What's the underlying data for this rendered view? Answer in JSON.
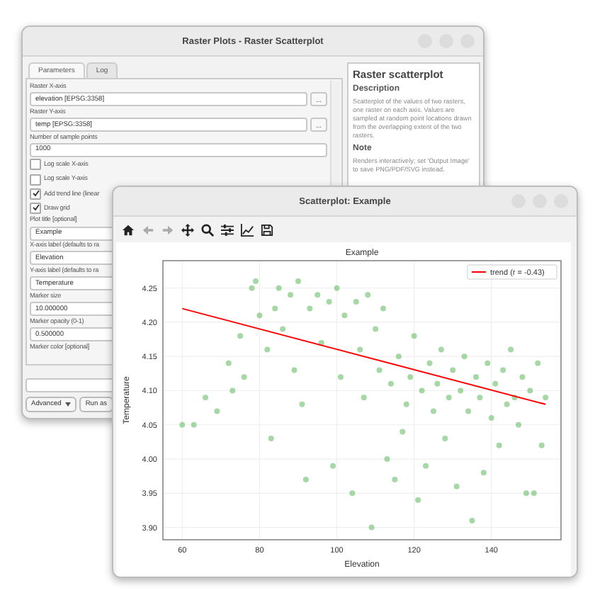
{
  "back_window": {
    "title": "Raster Plots - Raster Scatterplot",
    "tabs": [
      {
        "label": "Parameters",
        "selected": true
      },
      {
        "label": "Log",
        "selected": false
      }
    ],
    "parameters": [
      {
        "kind": "combo",
        "label": "Raster X-axis",
        "value": "elevation [EPSG:3358]",
        "button": "..."
      },
      {
        "kind": "combo",
        "label": "Raster Y-axis",
        "value": "temp [EPSG:3358]",
        "button": "..."
      },
      {
        "kind": "number",
        "label": "Number of sample points",
        "value": "1000"
      },
      {
        "kind": "checkbox",
        "label": "Log scale X-axis",
        "checked": false
      },
      {
        "kind": "checkbox",
        "label": "Log scale Y-axis",
        "checked": false
      },
      {
        "kind": "checkbox",
        "label": "Add trend line (linear",
        "checked": true
      },
      {
        "kind": "checkbox",
        "label": "Draw grid",
        "checked": true
      },
      {
        "kind": "text",
        "label": "Plot title [optional]",
        "value": "Example"
      },
      {
        "kind": "text",
        "label": "X-axis label (defaults to ra",
        "value": "Elevation"
      },
      {
        "kind": "text",
        "label": "Y-axis label (defaults to ra",
        "value": "Temperature"
      },
      {
        "kind": "text",
        "label": "Marker size",
        "value": "10.000000"
      },
      {
        "kind": "text",
        "label": "Marker opacity (0-1)",
        "value": "0.500000"
      },
      {
        "kind": "heading",
        "label": "Marker color [optional]"
      }
    ],
    "buttons": [
      {
        "label": "Advanced",
        "kind": "menu"
      },
      {
        "label": "Run as",
        "kind": "plain"
      }
    ],
    "help": {
      "title": "Raster scatterplot",
      "sections": [
        {
          "heading": "Description",
          "text": "Scatterplot of the values of two rasters, one raster on each axis. Values are sampled at random point locations drawn from the overlapping extent of the two rasters."
        },
        {
          "heading": "Note",
          "text": "Renders interactively; set 'Output Image' to save PNG/PDF/SVG instead."
        }
      ]
    }
  },
  "plot_window": {
    "title": "Scatterplot: Example",
    "toolbar": [
      {
        "kind": "home",
        "disabled": false
      },
      {
        "kind": "back",
        "disabled": true
      },
      {
        "kind": "forward",
        "disabled": true
      },
      {
        "kind": "pan",
        "disabled": false
      },
      {
        "kind": "zoom",
        "disabled": false
      },
      {
        "kind": "configure",
        "disabled": false
      },
      {
        "kind": "axes",
        "disabled": false
      },
      {
        "kind": "save",
        "disabled": false
      }
    ],
    "chart_data": {
      "type": "scatter",
      "title": "Example",
      "xlabel": "Elevation",
      "ylabel": "Temperature",
      "xlim": [
        55,
        158
      ],
      "ylim": [
        3.882,
        4.29
      ],
      "xticks": [
        60,
        80,
        100,
        120,
        140
      ],
      "yticks": [
        {
          "value": 3.9,
          "label": "3.90"
        },
        {
          "value": 3.95,
          "label": "3.95"
        },
        {
          "value": 4.0,
          "label": "4.00"
        },
        {
          "value": 4.05,
          "label": "4.05"
        },
        {
          "value": 4.1,
          "label": "4.10"
        },
        {
          "value": 4.15,
          "label": "4.15"
        },
        {
          "value": 4.2,
          "label": "4.20"
        },
        {
          "value": 4.25,
          "label": "4.25"
        }
      ],
      "series": [
        {
          "name": "trend (r = -0.43)",
          "type": "line",
          "color": "#ff0000",
          "x": [
            60,
            154
          ],
          "values": [
            4.22,
            4.08
          ]
        },
        {
          "color": "#5cb85c",
          "x": [
            60,
            63,
            66,
            69,
            72,
            73,
            75,
            76,
            78,
            79,
            80,
            82,
            83,
            84,
            85,
            86,
            88,
            89,
            90,
            91,
            92,
            93,
            95,
            96,
            98,
            99,
            100,
            101,
            102,
            104,
            105,
            106,
            107,
            108,
            109,
            110,
            111,
            112,
            113,
            114,
            115,
            116,
            117,
            118,
            119,
            120,
            121,
            122,
            123,
            124,
            125,
            126,
            127,
            128,
            129,
            130,
            131,
            132,
            133,
            134,
            135,
            136,
            137,
            138,
            139,
            140,
            141,
            142,
            143,
            144,
            145,
            146,
            147,
            148,
            149,
            150,
            151,
            152,
            153,
            154
          ],
          "values": [
            4.05,
            4.05,
            4.09,
            4.07,
            4.14,
            4.1,
            4.18,
            4.12,
            4.25,
            4.26,
            4.21,
            4.16,
            4.03,
            4.22,
            4.25,
            4.19,
            4.24,
            4.13,
            4.26,
            4.08,
            3.97,
            4.22,
            4.24,
            4.17,
            4.23,
            3.99,
            4.25,
            4.12,
            4.21,
            3.95,
            4.23,
            4.16,
            4.09,
            4.24,
            3.9,
            4.19,
            4.13,
            4.22,
            4.0,
            4.11,
            3.97,
            4.15,
            4.04,
            4.08,
            4.12,
            4.18,
            3.94,
            4.1,
            3.99,
            4.14,
            4.07,
            4.11,
            4.16,
            4.03,
            4.09,
            4.13,
            3.96,
            4.1,
            4.15,
            4.07,
            3.91,
            4.12,
            4.09,
            3.98,
            4.14,
            4.06,
            4.11,
            4.02,
            4.13,
            4.08,
            4.16,
            4.09,
            4.05,
            4.12,
            3.95,
            4.1,
            3.95,
            4.14,
            4.02,
            4.09
          ]
        }
      ],
      "grid": true
    }
  }
}
